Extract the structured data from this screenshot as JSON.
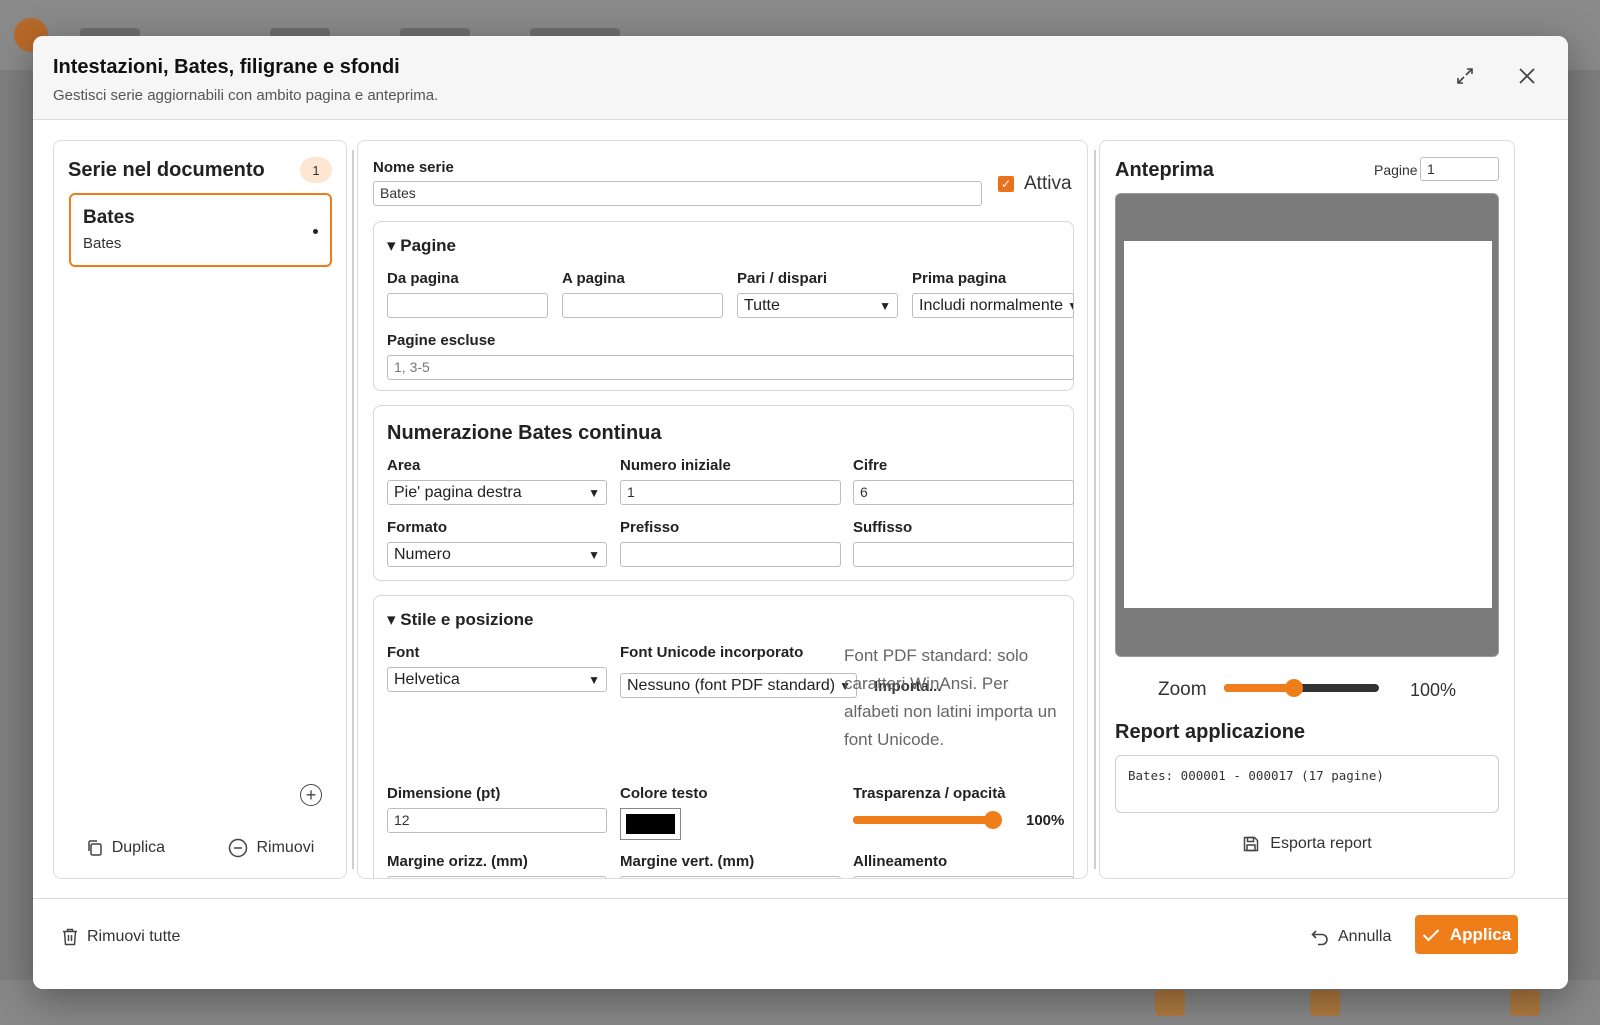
{
  "dialog": {
    "title": "Intestazioni, Bates, filigrane e sfondi",
    "subtitle": "Gestisci serie aggiornabili con ambito pagina e anteprima."
  },
  "left": {
    "title": "Serie nel documento",
    "count": "1",
    "series": [
      {
        "name": "Bates",
        "subtitle": "Bates"
      }
    ],
    "duplicate_label": "Duplica",
    "remove_label": "Rimuovi"
  },
  "editor": {
    "series_name_label": "Nome serie",
    "series_name_value": "Bates",
    "active_label": "Attiva",
    "active_checked": true,
    "pages": {
      "heading": "Pagine",
      "from_label": "Da pagina",
      "from_value": "",
      "to_label": "A pagina",
      "to_value": "",
      "parity_label": "Pari / dispari",
      "parity_value": "Tutte",
      "first_page_label": "Prima pagina",
      "first_page_value": "Includi normalmente",
      "excluded_label": "Pagine escluse",
      "excluded_placeholder": "1, 3-5"
    },
    "bates": {
      "heading": "Numerazione Bates continua",
      "area_label": "Area",
      "area_value": "Pie' pagina destra",
      "start_label": "Numero iniziale",
      "start_value": "1",
      "digits_label": "Cifre",
      "digits_value": "6",
      "format_label": "Formato",
      "format_value": "Numero",
      "prefix_label": "Prefisso",
      "prefix_value": "",
      "suffix_label": "Suffisso",
      "suffix_value": ""
    },
    "style": {
      "heading": "Stile e posizione",
      "font_label": "Font",
      "font_value": "Helvetica",
      "unicode_font_label": "Font Unicode incorporato",
      "unicode_font_value": "Nessuno (font PDF standard)",
      "import_label": "Importa...",
      "font_note": "Font PDF standard: solo caratteri WinAnsi. Per alfabeti non latini importa un font Unicode.",
      "size_label": "Dimensione (pt)",
      "size_value": "12",
      "color_label": "Colore testo",
      "text_color": "#000000",
      "opacity_label": "Trasparenza / opacità",
      "opacity_value": "100%",
      "opacity_fraction": 1.0,
      "margin_h_label": "Margine orizz. (mm)",
      "margin_v_label": "Margine vert. (mm)",
      "align_label": "Allineamento"
    }
  },
  "preview": {
    "title": "Anteprima",
    "pages_label": "Pagine",
    "pages_value": "1",
    "zoom_label": "Zoom",
    "zoom_value": "100%",
    "zoom_fraction": 0.45,
    "report_title": "Report applicazione",
    "report_text": "Bates: 000001 - 000017 (17 pagine)",
    "export_label": "Esporta report"
  },
  "footer": {
    "remove_all_label": "Rimuovi tutte",
    "cancel_label": "Annulla",
    "apply_label": "Applica"
  },
  "colors": {
    "accent": "#ef7d1a",
    "badge_bg": "#fde7d3"
  },
  "icons": [
    "expand-icon",
    "close-icon",
    "plus-circle-icon",
    "copy-icon",
    "minus-circle-icon",
    "save-icon",
    "trash-icon",
    "undo-icon",
    "check-icon"
  ]
}
